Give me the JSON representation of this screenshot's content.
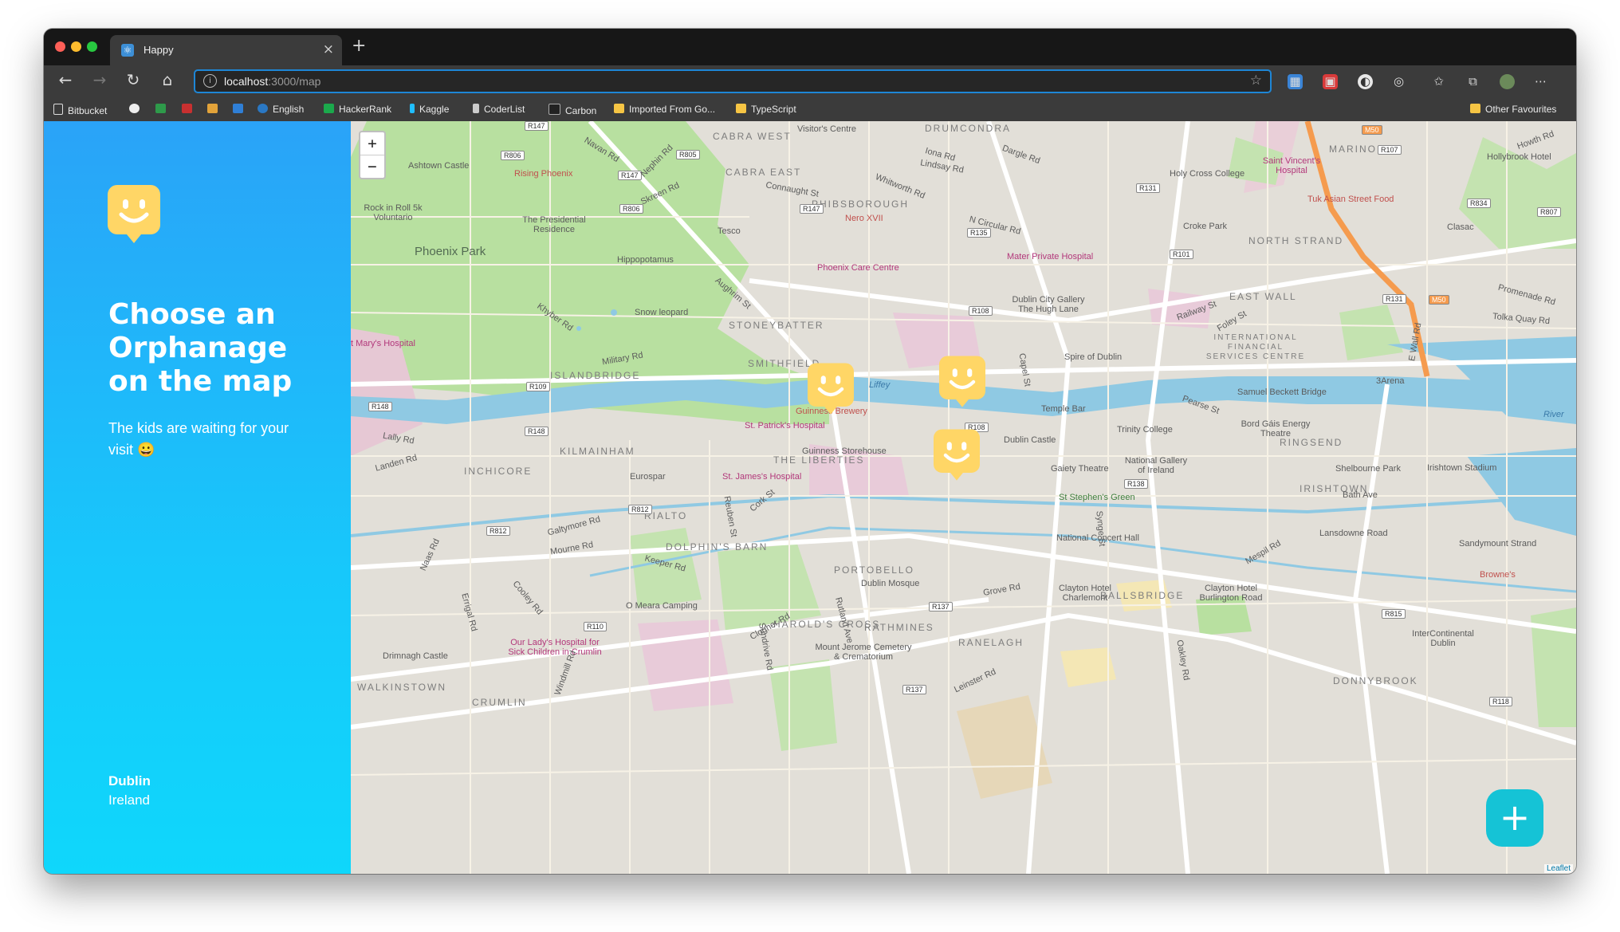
{
  "browser": {
    "tab_title": "Happy",
    "tab_close": "×",
    "new_tab": "+",
    "url_host": "localhost",
    "url_path": ":3000/map",
    "bookmarks": [
      "Bitbucket",
      "English",
      "HackerRank",
      "Kaggle",
      "CoderList",
      "Carbon",
      "Imported From Go...",
      "TypeScript"
    ],
    "other_favourites": "Other Favourites"
  },
  "sidebar": {
    "title": "Choose an Orphanage on the map",
    "subtitle": "The kids are waiting for your visit 😀",
    "city": "Dublin",
    "country": "Ireland"
  },
  "map": {
    "zoom_in": "+",
    "zoom_out": "−",
    "attribution": "Leaflet",
    "add_button": "+",
    "areas": [
      "CABRA WEST",
      "CABRA EAST",
      "PHIBSBOROUGH",
      "DRUMCONDRA",
      "MARINO",
      "NORTH STRAND",
      "EAST WALL",
      "STONEYBATTER",
      "SMITHFIELD",
      "ISLANDBRIDGE",
      "KILMAINHAM",
      "INCHICORE",
      "THE LIBERTIES",
      "RIALTO",
      "DOLPHIN'S BARN",
      "PORTOBELLO",
      "HAROLD'S CROSS",
      "RATHMINES",
      "RANELAGH",
      "BALLSBRIDGE",
      "DONNYBROOK",
      "RINGSEND",
      "IRISHTOWN",
      "WALKINSTOWN",
      "CRUMLIN",
      "INTERNATIONAL FINANCIAL SERVICES CENTRE"
    ],
    "places": [
      "Phoenix Park",
      "Ashtown Castle",
      "Rising Phoenix",
      "Rock in Roll 5k Voluntario",
      "The Presidential Residence",
      "Hippopotamus",
      "Snow leopard",
      "Tesco",
      "Nero XVII",
      "Phoenix Care Centre",
      "Mater Private Hospital",
      "Holy Cross College",
      "Croke Park",
      "Saint Vincent's Hospital",
      "Tuk Asian Street Food",
      "Hollybrook Hotel",
      "Clasac",
      "Dublin City Gallery The Hugh Lane",
      "Spire of Dublin",
      "Temple Bar",
      "Trinity College",
      "Samuel Beckett Bridge",
      "3Arena",
      "Bord Gáis Energy Theatre",
      "Guinness Brewery",
      "St. Patrick's Hospital",
      "Guinness Storehouse",
      "Dublin Castle",
      "Gaiety Theatre",
      "National Gallery of Ireland",
      "St Stephen's Green",
      "St. James's Hospital",
      "Eurospar",
      "National Concert Hall",
      "Shelbourne Park",
      "Irishtown Stadium",
      "Lansdowne Road",
      "Sandymount Strand",
      "Browne's",
      "Clayton Hotel Charlemont",
      "Clayton Hotel Burlington Road",
      "Dublin Mosque",
      "O Meara Camping",
      "Mount Jerome Cemetery & Crematorium",
      "Our Lady's Hospital for Sick Children in Crumlin",
      "Drimnagh Castle",
      "InterContinental Dublin",
      "t Mary's Hospital",
      "Visitor's Centre",
      "Liffey",
      "River"
    ],
    "roads": [
      "Navan Rd",
      "Nephin Rd",
      "Skreen Rd",
      "Connaught St",
      "Whitworth Rd",
      "N Circular Rd",
      "Aughrim St",
      "Khyber Rd",
      "Military Rd",
      "Pearse St",
      "Capel St",
      "Cork St",
      "Reuben St",
      "Grove Rd",
      "Mespil Rd",
      "Clogher Rd",
      "Galtymore Rd",
      "Mourne Rd",
      "Keeper Rd",
      "Naas Rd",
      "Landen Rd",
      "Lally Rd",
      "Bath Ave",
      "Promenade Rd",
      "Tolka Quay Rd",
      "Howth Rd",
      "Railway St",
      "Foley St",
      "E Wall Rd",
      "Leinster Rd",
      "Iona Rd",
      "Dargle Rd",
      "Lindsay Rd",
      "Synge St",
      "Sundrive Rd",
      "Oakley Rd",
      "Rutland Ave",
      "Windmill Rd",
      "Cooley Rd",
      "Errigal Rd"
    ],
    "route_shields": [
      "R147",
      "R806",
      "R805",
      "R147",
      "R806",
      "R147",
      "R135",
      "R101",
      "R131",
      "R108",
      "R109",
      "R148",
      "R148",
      "R108",
      "R812",
      "R812",
      "R110",
      "R137",
      "R137",
      "R138",
      "R131",
      "R815",
      "R118",
      "R107",
      "R834",
      "R807",
      "M50",
      "M50"
    ]
  }
}
